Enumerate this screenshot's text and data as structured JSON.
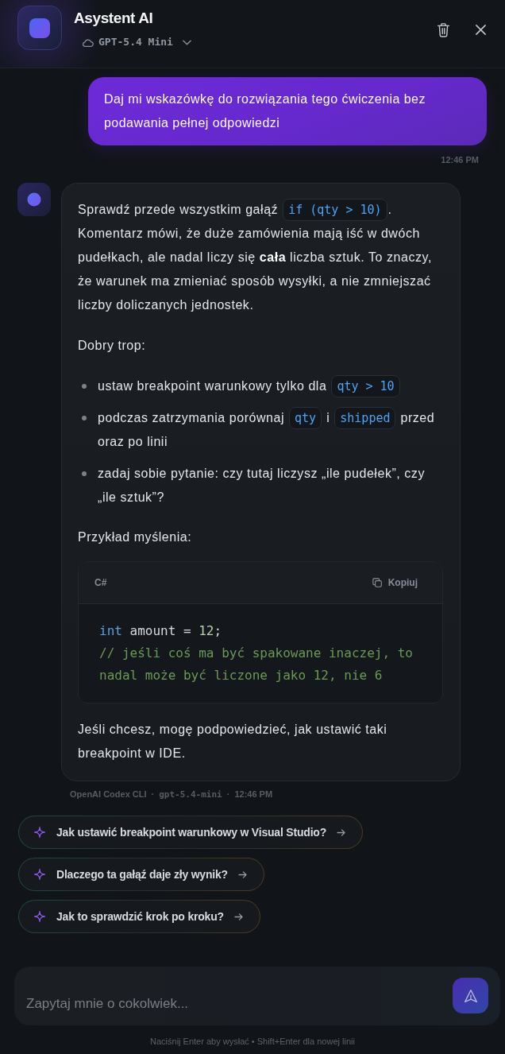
{
  "header": {
    "title": "Asystent AI",
    "model": "GPT-5.4 Mini"
  },
  "messages": [
    {
      "kind": "user",
      "text": "Daj mi wskazówkę do rozwiązania tego ćwiczenia bez podawania pełnej odpowiedzi",
      "time": "12:46 PM"
    },
    {
      "kind": "assistant",
      "blocks": [
        {
          "kind": "paragraph",
          "parts": [
            {
              "kind": "text",
              "text": "Sprawdź przede wszystkim gałąź "
            },
            {
              "kind": "code",
              "text": "if (qty > 10)"
            },
            {
              "kind": "text",
              "text": ". Komentarz mówi, że duże zamówienia mają iść w dwóch pudełkach, ale nadal liczy się **cała** liczba sztuk. To znaczy, że warunek ma zmieniać sposób wysyłki, a nie zmniejszać liczby doliczanych jednostek."
            }
          ]
        },
        {
          "kind": "paragraph",
          "parts": [
            {
              "kind": "text",
              "text": "Dobry trop:"
            }
          ]
        },
        {
          "kind": "list",
          "items": [
            {
              "parts": [
                {
                  "kind": "text",
                  "text": "ustaw breakpoint warunkowy tylko dla "
                },
                {
                  "kind": "code",
                  "text": "qty > 10"
                }
              ]
            },
            {
              "parts": [
                {
                  "kind": "text",
                  "text": "podczas zatrzymania porównaj "
                },
                {
                  "kind": "code",
                  "text": "qty"
                },
                {
                  "kind": "text",
                  "text": " i "
                },
                {
                  "kind": "code",
                  "text": "shipped"
                },
                {
                  "kind": "text",
                  "text": " przed oraz po linii"
                }
              ]
            },
            {
              "parts": [
                {
                  "kind": "text",
                  "text": "zadaj sobie pytanie: czy tutaj liczysz „ile pudełek”, czy „ile sztuk”?"
                }
              ]
            }
          ]
        },
        {
          "kind": "paragraph",
          "parts": [
            {
              "kind": "text",
              "text": "Przykład myślenia:"
            }
          ]
        },
        {
          "kind": "code_block",
          "language": "C#",
          "copy_label": "Kopiuj",
          "lines": [
            {
              "tokens": [
                {
                  "kind": "keyword",
                  "text": "int"
                },
                {
                  "kind": "plain",
                  "text": " amount = "
                },
                {
                  "kind": "number",
                  "text": "12"
                },
                {
                  "kind": "plain",
                  "text": ";"
                }
              ]
            },
            {
              "tokens": [
                {
                  "kind": "comment",
                  "text": "// jeśli coś ma być spakowane inaczej, to nadal może być liczone jako 12, nie 6"
                }
              ]
            }
          ]
        },
        {
          "kind": "paragraph",
          "parts": [
            {
              "kind": "text",
              "text": "Jeśli chcesz, mogę podpowiedzieć, jak ustawić taki breakpoint w IDE."
            }
          ]
        }
      ],
      "meta": [
        {
          "kind": "text",
          "text": "OpenAI Codex CLI"
        },
        {
          "kind": "separator",
          "text": "·"
        },
        {
          "kind": "mono",
          "text": "gpt-5.4-mini"
        },
        {
          "kind": "separator",
          "text": "·"
        },
        {
          "kind": "text",
          "text": "12:46 PM"
        }
      ]
    }
  ],
  "suggestions": [
    {
      "text": "Jak ustawić breakpoint warunkowy w Visual Studio?"
    },
    {
      "text": "Dlaczego ta gałąź daje zły wynik?"
    },
    {
      "text": "Jak to sprawdzić krok po kroku?"
    }
  ],
  "composer": {
    "placeholder": "Zapytaj mnie o cokolwiek..."
  },
  "hint": "Naciśnij Enter aby wysłać • Shift+Enter dla nowej linii"
}
